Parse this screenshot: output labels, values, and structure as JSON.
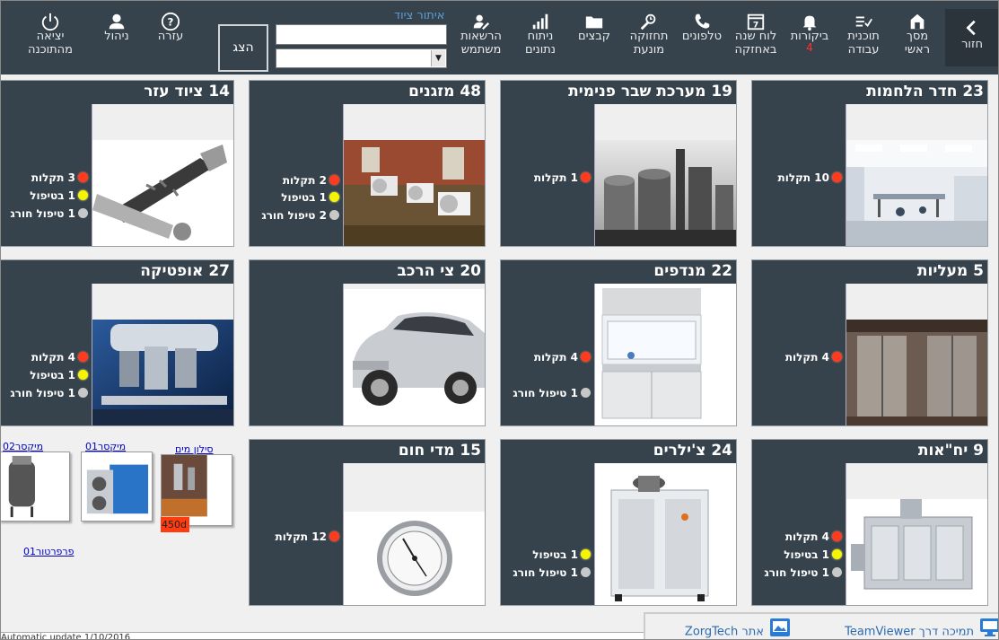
{
  "toolbar": {
    "buttons": [
      {
        "id": "back",
        "label": "חזור",
        "icon": "chevron-left-icon"
      },
      {
        "id": "home",
        "label": "מסך\nראשי",
        "icon": "home-icon"
      },
      {
        "id": "workplan",
        "label": "תוכנית\nעבודה",
        "icon": "checklist-icon"
      },
      {
        "id": "visits",
        "label": "ביקורות",
        "badge": "4",
        "icon": "bell-icon"
      },
      {
        "id": "annual",
        "label": "לוח שנה\nבאחזקה",
        "icon": "calendar-icon",
        "icon_text": "7"
      },
      {
        "id": "phones",
        "label": "טלפונים",
        "icon": "phone-icon"
      },
      {
        "id": "preventive",
        "label": "תחזוקה\nמונעת",
        "icon": "wrench-clock-icon"
      },
      {
        "id": "files",
        "label": "קבצים",
        "icon": "folder-icon"
      },
      {
        "id": "analysis",
        "label": "ניתוח\nנתונים",
        "icon": "signal-bars-icon"
      },
      {
        "id": "permissions",
        "label": "הרשאות\nמשתמש",
        "icon": "user-edit-icon"
      },
      {
        "id": "help",
        "label": "עזרה",
        "icon": "help-circle-icon"
      },
      {
        "id": "admin",
        "label": "ניהול",
        "icon": "user-icon"
      },
      {
        "id": "exit",
        "label": "יציאה\nמהתוכנה",
        "icon": "power-icon"
      }
    ],
    "search_link": "איתור ציוד",
    "search_value": "",
    "select_value": "",
    "show_button": "הצג"
  },
  "cards": [
    {
      "title": "23 חדר הלחמות",
      "image": "cleanroom-image",
      "stats": [
        {
          "color": "red",
          "text": "10 תקלות"
        }
      ]
    },
    {
      "title": "19 מערכת שבר פנימית",
      "image": "silos-image",
      "stats": [
        {
          "color": "red",
          "text": "1 תקלות"
        }
      ]
    },
    {
      "title": "48 מזגנים",
      "image": "air-conditioners-image",
      "stats": [
        {
          "color": "red",
          "text": "2 תקלות"
        },
        {
          "color": "yellow",
          "text": "1 בטיפול"
        },
        {
          "color": "gray",
          "text": "2 טיפול חורג"
        }
      ]
    },
    {
      "title": "14 ציוד עזר",
      "image": "tools-image",
      "stats": [
        {
          "color": "red",
          "text": "3 תקלות"
        },
        {
          "color": "yellow",
          "text": "1 בטיפול"
        },
        {
          "color": "gray",
          "text": "1 טיפול חורג"
        }
      ]
    },
    {
      "title": "5 מעליות",
      "image": "elevator-image",
      "stats": [
        {
          "color": "red",
          "text": "4 תקלות"
        }
      ]
    },
    {
      "title": "22 מנדפים",
      "image": "fume-hood-image",
      "stats": [
        {
          "color": "red",
          "text": "4 תקלות"
        },
        {
          "color": "gray",
          "text": "1 טיפול חורג"
        }
      ]
    },
    {
      "title": "20 צי הרכב",
      "image": "car-image",
      "stats": []
    },
    {
      "title": "27 אופטיקה",
      "image": "microscope-image",
      "stats": [
        {
          "color": "red",
          "text": "4 תקלות"
        },
        {
          "color": "yellow",
          "text": "1 בטיפול"
        },
        {
          "color": "gray",
          "text": "1 טיפול חורג"
        }
      ]
    },
    {
      "title": "9 יח\"אות",
      "image": "air-handler-image",
      "stats": [
        {
          "color": "red",
          "text": "4 תקלות"
        },
        {
          "color": "yellow",
          "text": "1 בטיפול"
        },
        {
          "color": "gray",
          "text": "1 טיפול חורג"
        }
      ]
    },
    {
      "title": "24 צ'ילרים",
      "image": "chiller-image",
      "stats": [
        {
          "color": "yellow",
          "text": "1 בטיפול"
        },
        {
          "color": "gray",
          "text": "1 טיפול חורג"
        }
      ]
    },
    {
      "title": "15 מדי חום",
      "image": "thermometer-image",
      "stats": [
        {
          "color": "red",
          "text": "12 תקלות"
        }
      ]
    }
  ],
  "small_items": [
    {
      "label": "סילון מים",
      "chip": "450d",
      "image": "water-jet-image"
    },
    {
      "label": "מיקסר01",
      "image": "mixer-image"
    },
    {
      "label": "מיקסר02",
      "image": "tank-image"
    },
    {
      "label": "פרפרטור01"
    }
  ],
  "bottom": {
    "teamviewer": "תמיכה דרך TeamViewer",
    "zorgtech": "אתר ZorgTech"
  },
  "status_strip": "Automatic update  1/10/2016"
}
